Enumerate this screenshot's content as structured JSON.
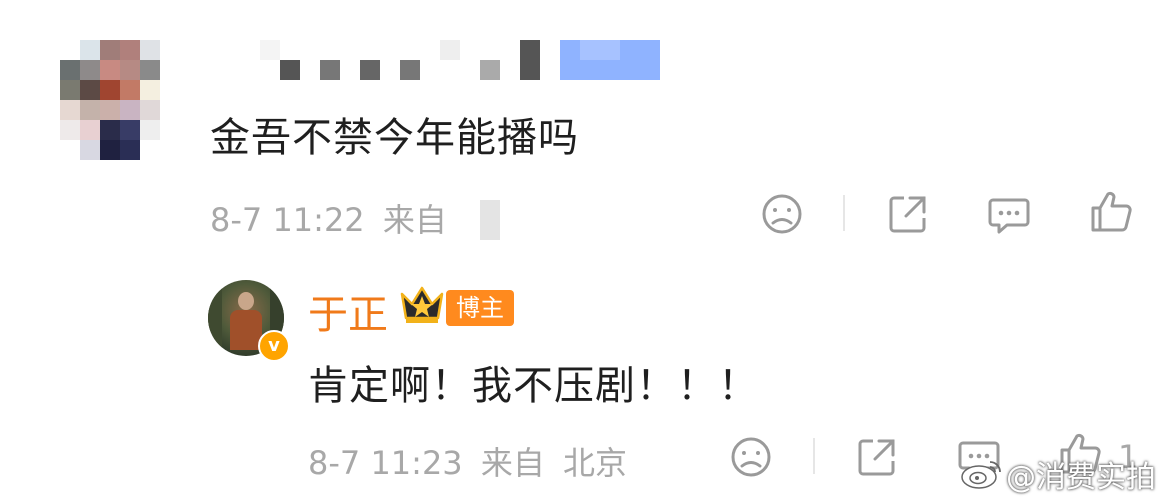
{
  "comment": {
    "text": "金吾不禁今年能播吗",
    "time": "8-7 11:22",
    "source_prefix": "来自",
    "actions": [
      {
        "name": "dislike-icon",
        "label": "dislike"
      },
      {
        "name": "share-icon",
        "label": "share"
      },
      {
        "name": "comment-icon",
        "label": "comment"
      },
      {
        "name": "like-icon",
        "label": "like"
      }
    ]
  },
  "reply": {
    "author": "于正",
    "badge": "博主",
    "text": "肯定啊！我不压剧！！！",
    "time": "8-7 11:23",
    "source_prefix": "来自",
    "source_location": "北京",
    "like_count": "1"
  },
  "watermark": {
    "text": "@消费实拍"
  },
  "colors": {
    "author": "#f07a1a",
    "badge": "#ff8a1e",
    "meta": "#a8a8a8",
    "icon": "#9a9a9a"
  }
}
